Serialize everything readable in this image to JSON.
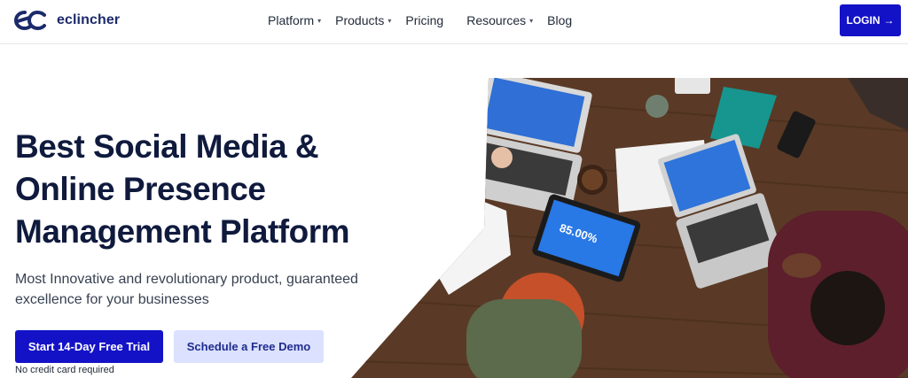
{
  "header": {
    "brand": "eclincher",
    "nav": [
      {
        "label": "Platform",
        "has_dropdown": true
      },
      {
        "label": "Products",
        "has_dropdown": true
      },
      {
        "label": "Pricing",
        "has_dropdown": false
      },
      {
        "label": "Resources",
        "has_dropdown": true
      },
      {
        "label": "Blog",
        "has_dropdown": false
      }
    ],
    "dropdown_glyph": "▾",
    "login_label": "LOGIN",
    "login_arrow": "→"
  },
  "hero": {
    "title_lines": [
      "Best Social Media &",
      "Online Presence",
      "Management Platform"
    ],
    "subtitle": "Most Innovative and revolutionary product, guaranteed excellence for your businesses",
    "primary_cta": "Start 14-Day Free Trial",
    "secondary_cta": "Schedule a Free Demo",
    "note": "No credit card required",
    "image_stat": "85.00%"
  },
  "colors": {
    "brand_blue": "#1412c7",
    "logo_navy": "#1b2a6b",
    "title_navy": "#0f1a3d",
    "demo_bg": "#dbe1ff",
    "table_wood": "#5a3a26"
  },
  "icons": [
    "logo-ec-icon",
    "chevron-down-icon",
    "arrow-right-icon"
  ]
}
